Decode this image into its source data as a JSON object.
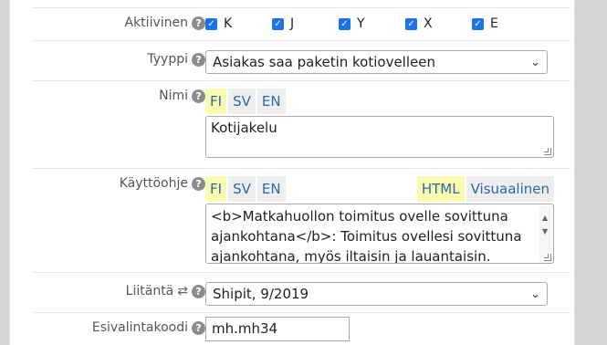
{
  "active": {
    "label": "Aktiivinen",
    "options": [
      {
        "label": "K",
        "checked": true
      },
      {
        "label": "J",
        "checked": true
      },
      {
        "label": "Y",
        "checked": true
      },
      {
        "label": "X",
        "checked": true
      },
      {
        "label": "E",
        "checked": true
      }
    ]
  },
  "type": {
    "label": "Tyyppi",
    "value": "Asiakas saa paketin kotiovelleen"
  },
  "name": {
    "label": "Nimi",
    "tabs": [
      "FI",
      "SV",
      "EN"
    ],
    "value": "Kotijakelu"
  },
  "instructions": {
    "label": "Käyttöohje",
    "lang_tabs": [
      "FI",
      "SV",
      "EN"
    ],
    "mode_tabs": [
      "HTML",
      "Visuaalinen"
    ],
    "lines": [
      "<b>Matkahuollon toimitus ovelle sovittuna",
      "ajankohtana</b>: Toimitus ovellesi sovittuna",
      "ajankohtana, myös iltaisin ja lauantaisin."
    ]
  },
  "integration": {
    "label": "Liitäntä",
    "value": "Shipit, 9/2019"
  },
  "preselect": {
    "label": "Esivalintakoodi",
    "value": "mh.mh34"
  },
  "icons": {
    "help": "help-icon",
    "swap": "swap-arrows-icon",
    "chevron": "chevron-down-icon",
    "check": "checkmark-icon"
  },
  "colors": {
    "accent": "#1a73e8",
    "tab_active": "#fbfbb0",
    "tab_inactive": "#eeeeee",
    "link": "#2a6aa6"
  }
}
